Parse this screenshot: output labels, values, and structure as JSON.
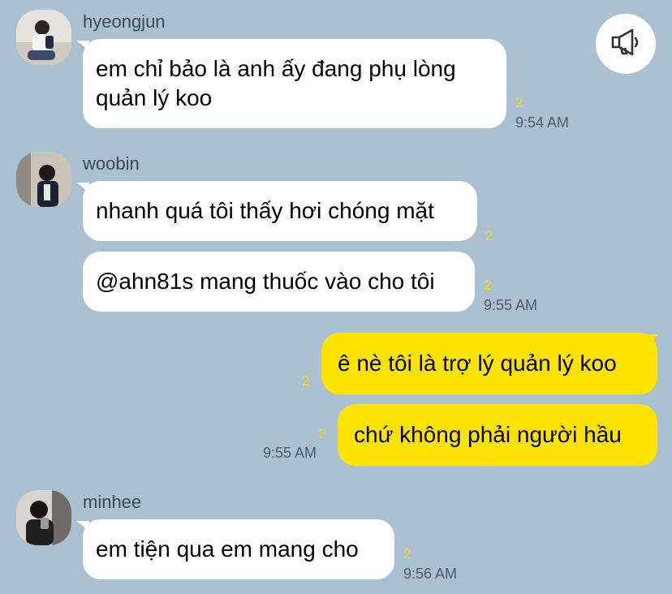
{
  "header": {
    "notice_icon": "megaphone-icon"
  },
  "messages": {
    "g1": {
      "sender": "hyeongjun",
      "line1": "em chỉ bảo là anh ấy đang phụ lòng",
      "line2": "quản lý koo",
      "unread": "2",
      "time": "9:54 AM"
    },
    "g2": {
      "sender": "woobin",
      "m1": {
        "text": "nhanh quá tôi thấy hơi chóng mặt",
        "unread": "2"
      },
      "m2": {
        "text": "@ahn81s mang thuốc vào cho tôi",
        "unread": "2",
        "time": "9:55 AM"
      }
    },
    "g3": {
      "m1": {
        "text": "ê nè tôi là trợ lý quản lý koo",
        "unread": "2"
      },
      "m2": {
        "text": "chứ không phải người hầu",
        "unread": "2",
        "time": "9:55 AM"
      }
    },
    "g4": {
      "sender": "minhee",
      "text": "em tiện qua em mang cho",
      "unread": "2",
      "time": "9:56 AM"
    }
  },
  "colors": {
    "background": "#abc1d1",
    "incoming_bubble": "#ffffff",
    "outgoing_bubble": "#fde300",
    "unread": "#f5e000"
  }
}
